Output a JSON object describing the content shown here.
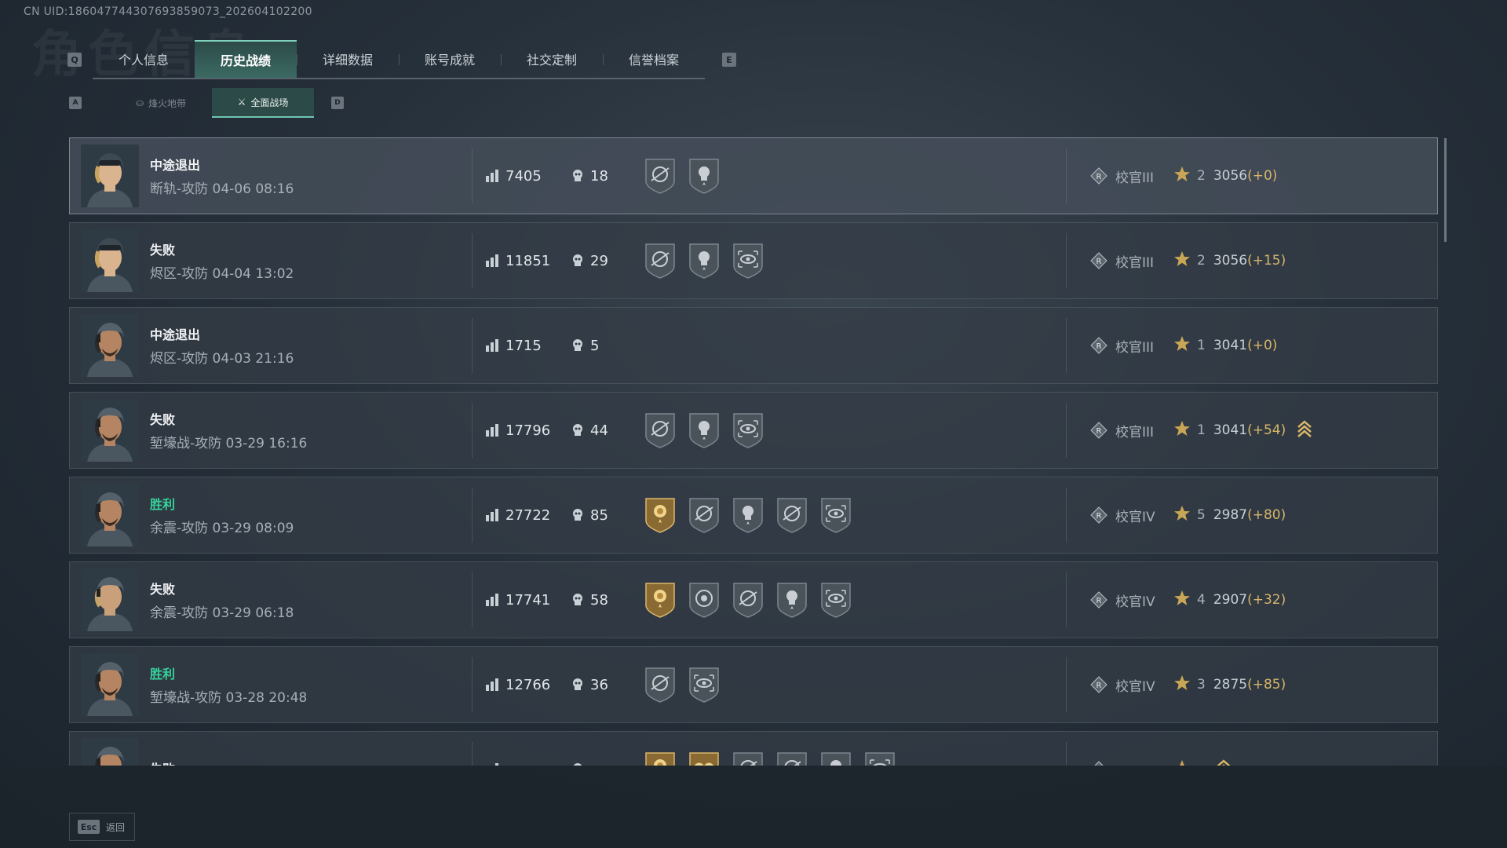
{
  "uid_text": "CN UID:18604774430769385907​3_202604102200",
  "bg_title": "角色信息",
  "tabs": {
    "left_key": "Q",
    "right_key": "E",
    "items": [
      "个人信息",
      "历史战绩",
      "详细数据",
      "账号成就",
      "社交定制",
      "信誉档案"
    ],
    "active_index": 1
  },
  "subtabs": {
    "left_key": "A",
    "right_key": "D",
    "items": [
      "烽火地带",
      "全面战场"
    ],
    "active_index": 1
  },
  "matches": [
    {
      "result": "中途退出",
      "result_type": "neutral",
      "map": "断轨-攻防",
      "time": "04-06 08:16",
      "score": "7405",
      "kills": "18",
      "medals": [
        "gray-crosshair",
        "gray-skull"
      ],
      "rank": "校官III",
      "stars": "2",
      "points": "3056",
      "delta": "(+0)",
      "rank_up": false,
      "avatar": "female"
    },
    {
      "result": "失败",
      "result_type": "loss",
      "map": "烬区-攻防",
      "time": "04-04 13:02",
      "score": "11851",
      "kills": "29",
      "medals": [
        "gray-crosshair",
        "gray-skull",
        "gray-eye"
      ],
      "rank": "校官III",
      "stars": "2",
      "points": "3056",
      "delta": "(+15)",
      "rank_up": false,
      "avatar": "female"
    },
    {
      "result": "中途退出",
      "result_type": "neutral",
      "map": "烬区-攻防",
      "time": "04-03 21:16",
      "score": "1715",
      "kills": "5",
      "medals": [],
      "rank": "校官III",
      "stars": "1",
      "points": "3041",
      "delta": "(+0)",
      "rank_up": false,
      "avatar": "male"
    },
    {
      "result": "失败",
      "result_type": "loss",
      "map": "堑壕战-攻防",
      "time": "03-29 16:16",
      "score": "17796",
      "kills": "44",
      "medals": [
        "gray-crosshair",
        "gray-skull",
        "gray-eye"
      ],
      "rank": "校官III",
      "stars": "1",
      "points": "3041",
      "delta": "(+54)",
      "rank_up": true,
      "avatar": "male"
    },
    {
      "result": "胜利",
      "result_type": "win",
      "map": "余震-攻防",
      "time": "03-29 08:09",
      "score": "27722",
      "kills": "85",
      "medals": [
        "gold-rose",
        "gray-crosshair",
        "gray-skull",
        "gray-crosshair",
        "gray-eye"
      ],
      "rank": "校官IV",
      "stars": "5",
      "points": "2987",
      "delta": "(+80)",
      "rank_up": false,
      "avatar": "male"
    },
    {
      "result": "失败",
      "result_type": "loss",
      "map": "余震-攻防",
      "time": "03-29 06:18",
      "score": "17741",
      "kills": "58",
      "medals": [
        "gold-rose",
        "gray-target-skull",
        "gray-crosshair",
        "gray-skull",
        "gray-eye"
      ],
      "rank": "校官IV",
      "stars": "4",
      "points": "2907",
      "delta": "(+32)",
      "rank_up": false,
      "avatar": "blond"
    },
    {
      "result": "胜利",
      "result_type": "win",
      "map": "堑壕战-攻防",
      "time": "03-28 20:48",
      "score": "12766",
      "kills": "36",
      "medals": [
        "gray-crosshair",
        "gray-eye"
      ],
      "rank": "校官IV",
      "stars": "3",
      "points": "2875",
      "delta": "(+85)",
      "rank_up": false,
      "avatar": "male"
    },
    {
      "result": "失败",
      "result_type": "loss",
      "map": "",
      "time": "",
      "score": "",
      "kills": "",
      "medals": [
        "gold-rose",
        "gold-wings",
        "gray-crosshair",
        "gray-crosshair",
        "gray-skull",
        "gray-eye"
      ],
      "rank": "",
      "stars": "",
      "points": "",
      "delta": "",
      "rank_up": true,
      "avatar": "male"
    }
  ],
  "back": {
    "key": "Esc",
    "label": "返回"
  },
  "colors": {
    "win": "#36d39c",
    "accent": "#7fd3bd",
    "gold": "#d7b56a"
  }
}
